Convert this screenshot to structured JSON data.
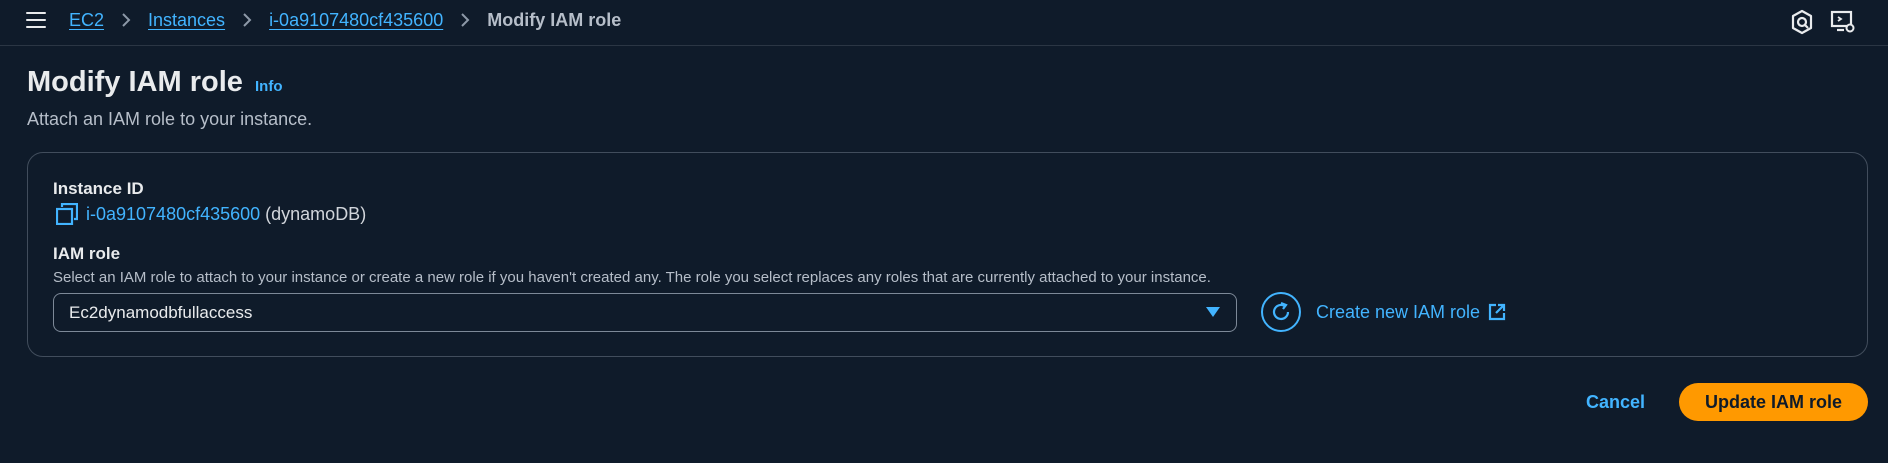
{
  "breadcrumb": {
    "items": [
      {
        "label": "EC2"
      },
      {
        "label": "Instances"
      },
      {
        "label": "i-0a9107480cf435600"
      }
    ],
    "current": "Modify IAM role"
  },
  "page": {
    "title": "Modify IAM role",
    "info_label": "Info",
    "subtitle": "Attach an IAM role to your instance."
  },
  "instance": {
    "label": "Instance ID",
    "id": "i-0a9107480cf435600",
    "name": "(dynamoDB)"
  },
  "iam_role": {
    "label": "IAM role",
    "description": "Select an IAM role to attach to your instance or create a new role if you haven't created any. The role you select replaces any roles that are currently attached to your instance.",
    "selected": "Ec2dynamodbfullaccess",
    "create_label": "Create new IAM role"
  },
  "actions": {
    "cancel_label": "Cancel",
    "submit_label": "Update IAM role"
  },
  "colors": {
    "background": "#0f1b2a",
    "link": "#42b4ff",
    "primary": "#ff9900",
    "text": "#e9ebed",
    "muted": "#b6bec9"
  },
  "icons": [
    "menu-icon",
    "chevron-right-icon",
    "support-icon",
    "screen-settings-icon",
    "copy-icon",
    "dropdown-caret-icon",
    "refresh-icon",
    "external-link-icon"
  ]
}
